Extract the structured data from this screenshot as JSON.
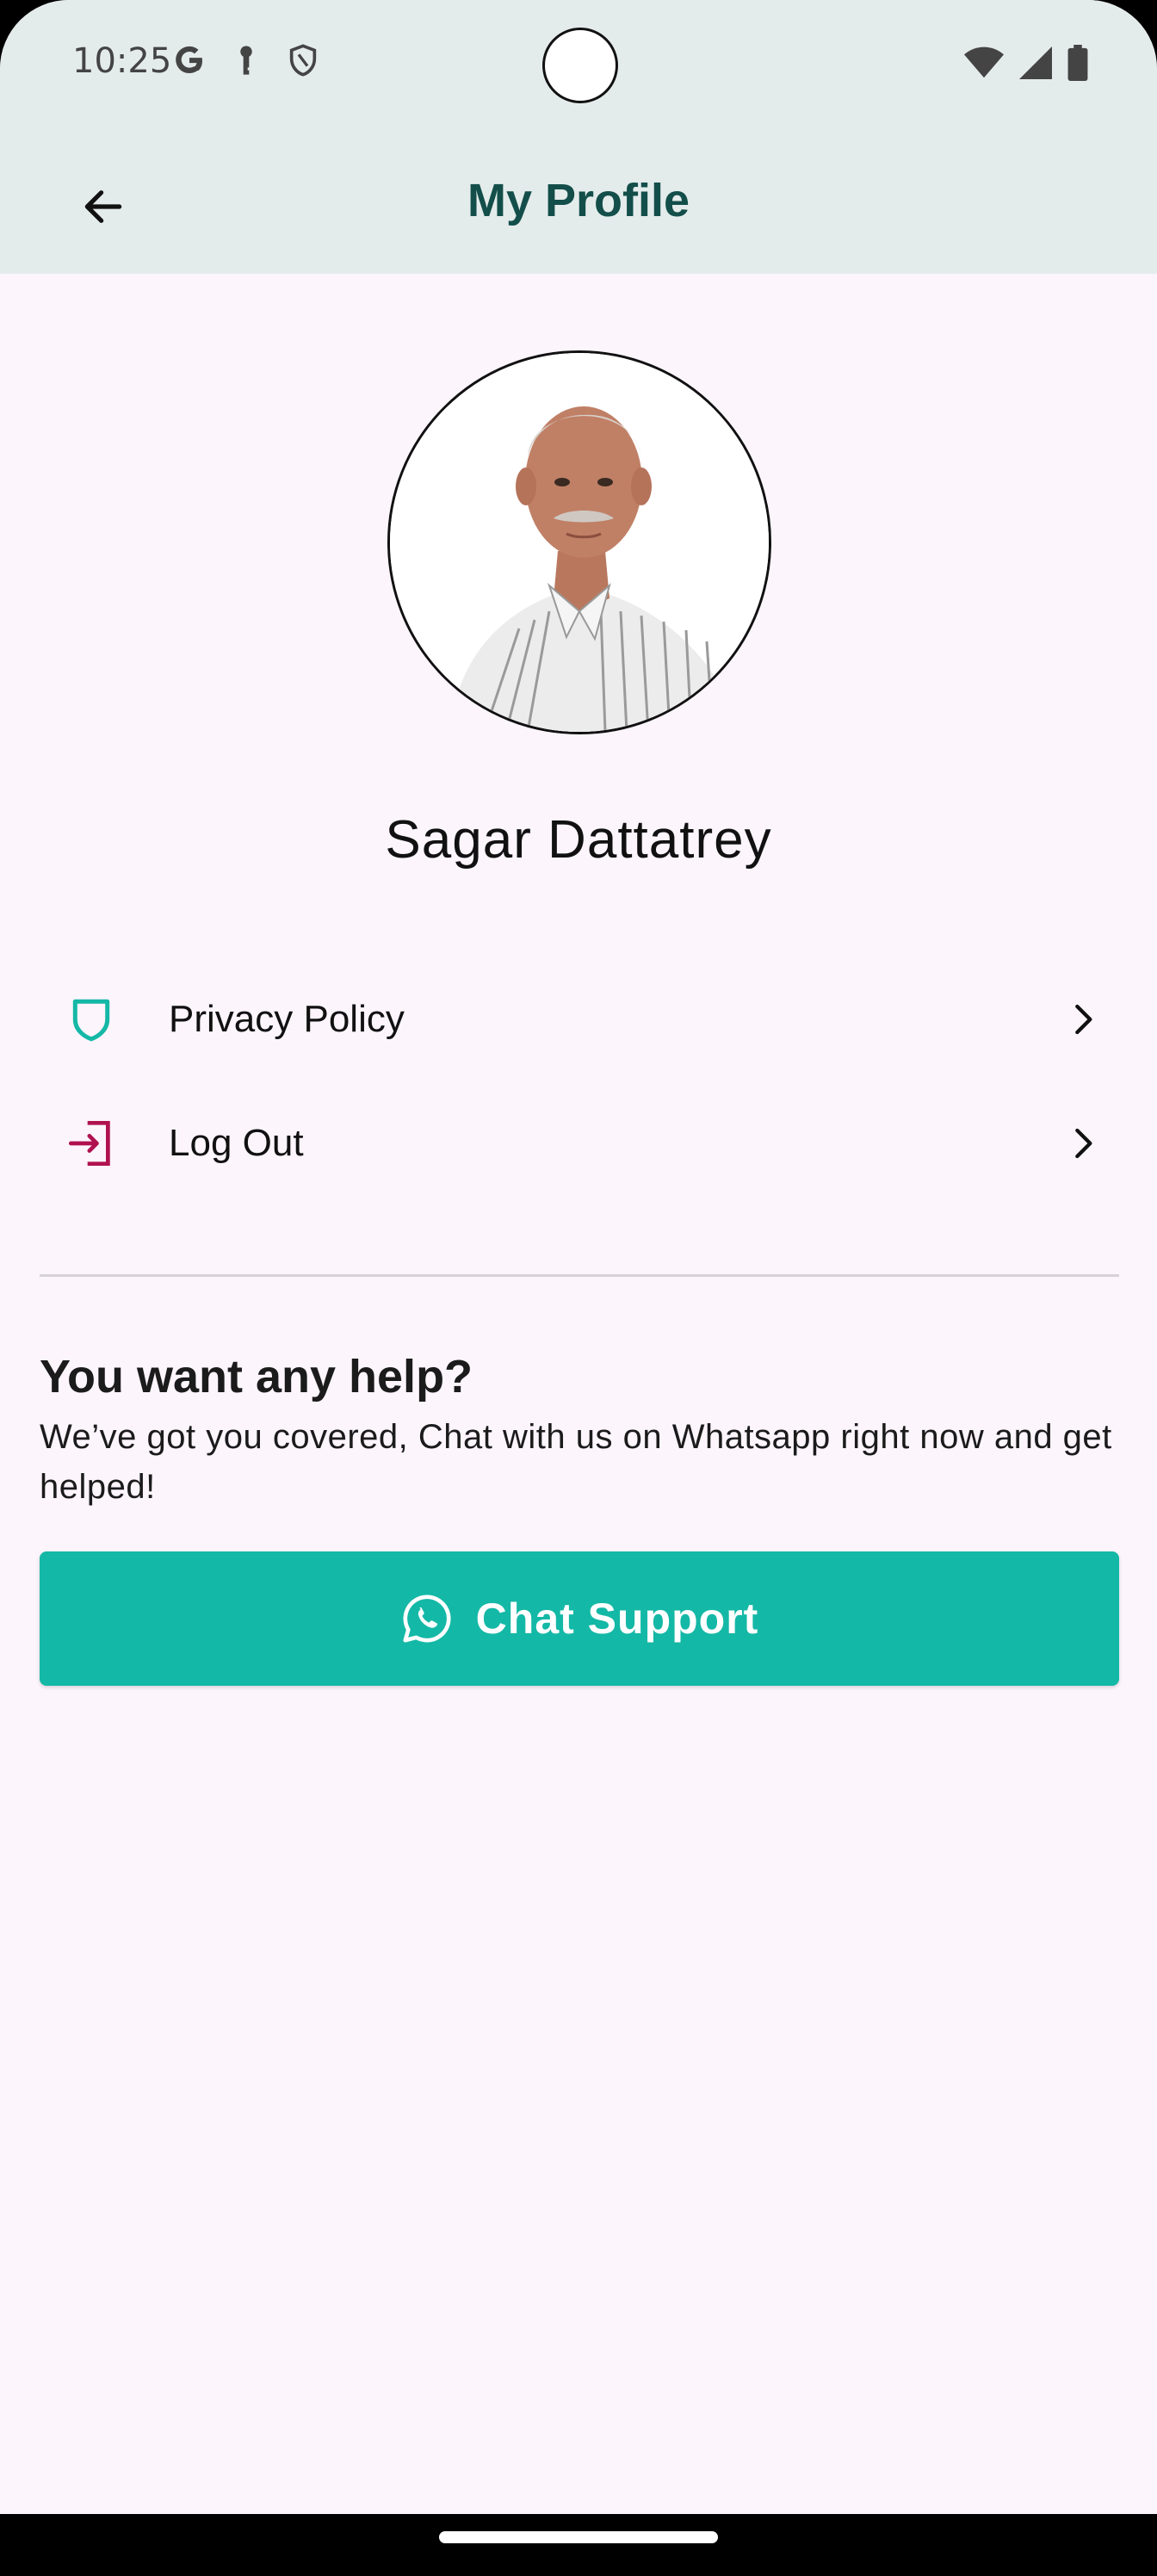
{
  "status_bar": {
    "time": "10:25",
    "left_icons": [
      "google-icon",
      "key-icon",
      "shield-icon"
    ],
    "right_icons": [
      "wifi-icon",
      "signal-icon",
      "battery-icon"
    ]
  },
  "header": {
    "title": "My Profile",
    "back_icon": "arrow-left-icon"
  },
  "profile": {
    "name": "Sagar Dattatrey",
    "avatar_icon": "profile-photo"
  },
  "menu": [
    {
      "label": "Privacy Policy",
      "icon": "shield-outline-icon",
      "icon_color": "#14B8A6"
    },
    {
      "label": "Log Out",
      "icon": "logout-icon",
      "icon_color": "#B0124F"
    }
  ],
  "help": {
    "title": "You want any help?",
    "text": "We’ve got you covered, Chat with us on Whatsapp right now and get helped!",
    "button_label": "Chat Support",
    "button_icon": "whatsapp-icon",
    "button_color": "#14B8A6"
  },
  "colors": {
    "title": "#134E4A",
    "background": "#FCF5FC",
    "topbar": "#E4ECEB"
  }
}
